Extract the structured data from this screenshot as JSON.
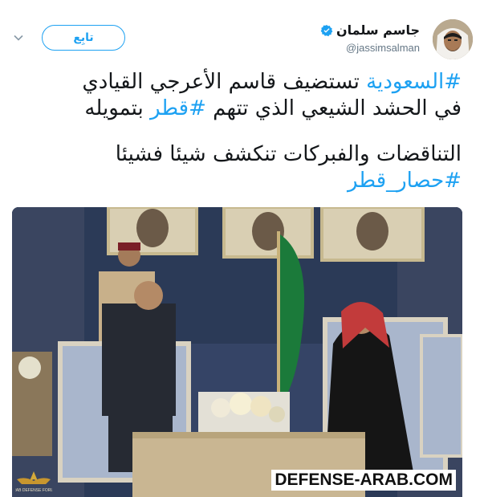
{
  "author": {
    "display_name": "جاسم سلمان",
    "handle": "@jassimsalman",
    "avatar_icon": "profile-photo"
  },
  "actions": {
    "follow_label": "تابِع",
    "menu_icon": "chevron-down-icon"
  },
  "tweet": {
    "line1": [
      {
        "text": "#السعودية",
        "hashtag": true
      },
      {
        "text": " تستضيف  قاسم الأعرجي القيادي",
        "hashtag": false
      }
    ],
    "line2": [
      {
        "text": "في الحشد الشيعي الذي تتهم ",
        "hashtag": false
      },
      {
        "text": "#قطر",
        "hashtag": true
      },
      {
        "text": " بتمويله",
        "hashtag": false
      }
    ],
    "line3": "التناقضات والفبركات تنكشف شيئا فشيئا",
    "line4": "#حصار_قطر"
  },
  "media": {
    "watermark": "DEFENSE-ARAB.COM",
    "watermark_logo_caption": "ARAB DEFENSE FORUM"
  },
  "colors": {
    "link": "#1da1f2",
    "text": "#14171a",
    "muted": "#657786"
  }
}
